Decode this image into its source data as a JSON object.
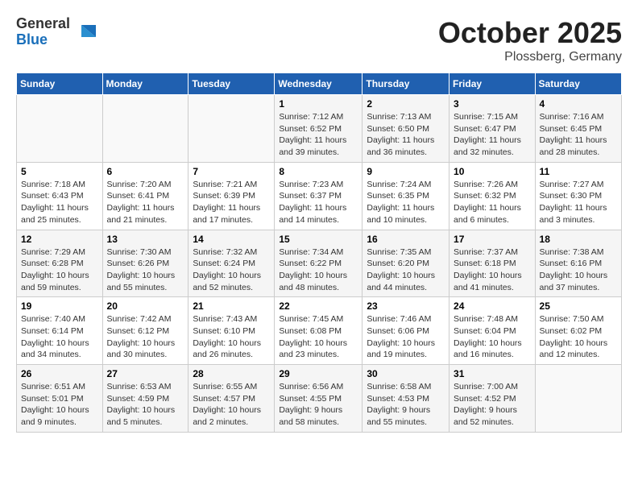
{
  "header": {
    "logo": {
      "general": "General",
      "blue": "Blue"
    },
    "title": "October 2025",
    "location": "Plossberg, Germany"
  },
  "weekdays": [
    "Sunday",
    "Monday",
    "Tuesday",
    "Wednesday",
    "Thursday",
    "Friday",
    "Saturday"
  ],
  "weeks": [
    [
      {
        "day": "",
        "info": ""
      },
      {
        "day": "",
        "info": ""
      },
      {
        "day": "",
        "info": ""
      },
      {
        "day": "1",
        "info": "Sunrise: 7:12 AM\nSunset: 6:52 PM\nDaylight: 11 hours\nand 39 minutes."
      },
      {
        "day": "2",
        "info": "Sunrise: 7:13 AM\nSunset: 6:50 PM\nDaylight: 11 hours\nand 36 minutes."
      },
      {
        "day": "3",
        "info": "Sunrise: 7:15 AM\nSunset: 6:47 PM\nDaylight: 11 hours\nand 32 minutes."
      },
      {
        "day": "4",
        "info": "Sunrise: 7:16 AM\nSunset: 6:45 PM\nDaylight: 11 hours\nand 28 minutes."
      }
    ],
    [
      {
        "day": "5",
        "info": "Sunrise: 7:18 AM\nSunset: 6:43 PM\nDaylight: 11 hours\nand 25 minutes."
      },
      {
        "day": "6",
        "info": "Sunrise: 7:20 AM\nSunset: 6:41 PM\nDaylight: 11 hours\nand 21 minutes."
      },
      {
        "day": "7",
        "info": "Sunrise: 7:21 AM\nSunset: 6:39 PM\nDaylight: 11 hours\nand 17 minutes."
      },
      {
        "day": "8",
        "info": "Sunrise: 7:23 AM\nSunset: 6:37 PM\nDaylight: 11 hours\nand 14 minutes."
      },
      {
        "day": "9",
        "info": "Sunrise: 7:24 AM\nSunset: 6:35 PM\nDaylight: 11 hours\nand 10 minutes."
      },
      {
        "day": "10",
        "info": "Sunrise: 7:26 AM\nSunset: 6:32 PM\nDaylight: 11 hours\nand 6 minutes."
      },
      {
        "day": "11",
        "info": "Sunrise: 7:27 AM\nSunset: 6:30 PM\nDaylight: 11 hours\nand 3 minutes."
      }
    ],
    [
      {
        "day": "12",
        "info": "Sunrise: 7:29 AM\nSunset: 6:28 PM\nDaylight: 10 hours\nand 59 minutes."
      },
      {
        "day": "13",
        "info": "Sunrise: 7:30 AM\nSunset: 6:26 PM\nDaylight: 10 hours\nand 55 minutes."
      },
      {
        "day": "14",
        "info": "Sunrise: 7:32 AM\nSunset: 6:24 PM\nDaylight: 10 hours\nand 52 minutes."
      },
      {
        "day": "15",
        "info": "Sunrise: 7:34 AM\nSunset: 6:22 PM\nDaylight: 10 hours\nand 48 minutes."
      },
      {
        "day": "16",
        "info": "Sunrise: 7:35 AM\nSunset: 6:20 PM\nDaylight: 10 hours\nand 44 minutes."
      },
      {
        "day": "17",
        "info": "Sunrise: 7:37 AM\nSunset: 6:18 PM\nDaylight: 10 hours\nand 41 minutes."
      },
      {
        "day": "18",
        "info": "Sunrise: 7:38 AM\nSunset: 6:16 PM\nDaylight: 10 hours\nand 37 minutes."
      }
    ],
    [
      {
        "day": "19",
        "info": "Sunrise: 7:40 AM\nSunset: 6:14 PM\nDaylight: 10 hours\nand 34 minutes."
      },
      {
        "day": "20",
        "info": "Sunrise: 7:42 AM\nSunset: 6:12 PM\nDaylight: 10 hours\nand 30 minutes."
      },
      {
        "day": "21",
        "info": "Sunrise: 7:43 AM\nSunset: 6:10 PM\nDaylight: 10 hours\nand 26 minutes."
      },
      {
        "day": "22",
        "info": "Sunrise: 7:45 AM\nSunset: 6:08 PM\nDaylight: 10 hours\nand 23 minutes."
      },
      {
        "day": "23",
        "info": "Sunrise: 7:46 AM\nSunset: 6:06 PM\nDaylight: 10 hours\nand 19 minutes."
      },
      {
        "day": "24",
        "info": "Sunrise: 7:48 AM\nSunset: 6:04 PM\nDaylight: 10 hours\nand 16 minutes."
      },
      {
        "day": "25",
        "info": "Sunrise: 7:50 AM\nSunset: 6:02 PM\nDaylight: 10 hours\nand 12 minutes."
      }
    ],
    [
      {
        "day": "26",
        "info": "Sunrise: 6:51 AM\nSunset: 5:01 PM\nDaylight: 10 hours\nand 9 minutes."
      },
      {
        "day": "27",
        "info": "Sunrise: 6:53 AM\nSunset: 4:59 PM\nDaylight: 10 hours\nand 5 minutes."
      },
      {
        "day": "28",
        "info": "Sunrise: 6:55 AM\nSunset: 4:57 PM\nDaylight: 10 hours\nand 2 minutes."
      },
      {
        "day": "29",
        "info": "Sunrise: 6:56 AM\nSunset: 4:55 PM\nDaylight: 9 hours\nand 58 minutes."
      },
      {
        "day": "30",
        "info": "Sunrise: 6:58 AM\nSunset: 4:53 PM\nDaylight: 9 hours\nand 55 minutes."
      },
      {
        "day": "31",
        "info": "Sunrise: 7:00 AM\nSunset: 4:52 PM\nDaylight: 9 hours\nand 52 minutes."
      },
      {
        "day": "",
        "info": ""
      }
    ]
  ]
}
